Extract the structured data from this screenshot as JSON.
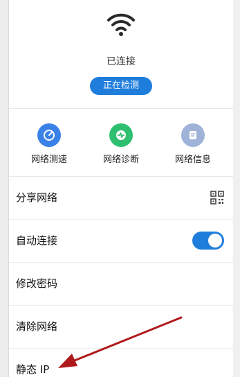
{
  "header": {
    "status": "已连接",
    "detect_button": "正在检测"
  },
  "quick_actions": [
    {
      "label": "网络测速",
      "icon": "speedometer-icon",
      "color": "#3b82e8"
    },
    {
      "label": "网络诊断",
      "icon": "pulse-icon",
      "color": "#2fbf71"
    },
    {
      "label": "网络信息",
      "icon": "document-icon",
      "color": "#9fb3d9"
    }
  ],
  "settings": [
    {
      "label": "分享网络",
      "control": "qr-code-icon"
    },
    {
      "label": "自动连接",
      "control": "toggle",
      "enabled": true
    },
    {
      "label": "修改密码"
    },
    {
      "label": "清除网络"
    },
    {
      "label": "静态 IP"
    }
  ],
  "colors": {
    "accent": "#1f7ddc",
    "annotation_arrow": "#b0191c"
  }
}
